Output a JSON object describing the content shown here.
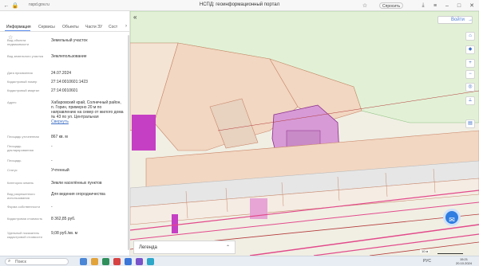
{
  "browser": {
    "url": "nspd.gov.ru",
    "page_title": "НСПД: геоинформационный портал",
    "share_label": "Спросить",
    "lang_label": "RU"
  },
  "panel": {
    "tabs": [
      {
        "label": "Информация"
      },
      {
        "label": "Сервисы"
      },
      {
        "label": "Объекты"
      },
      {
        "label": "Части ЗУ"
      },
      {
        "label": "Сост"
      }
    ],
    "more_icon": "chevron-right-icon",
    "star_icon": "star-icon",
    "rows": [
      {
        "label": "Вид объекта недвижимости",
        "value": "Земельный участок"
      },
      {
        "label": "Вид земельного участка",
        "value": "Землепользование"
      },
      {
        "label": "Дата присвоения",
        "value": "24.07.2024"
      },
      {
        "label": "Кадастровый номер",
        "value": "27:14:0010601:1423"
      },
      {
        "label": "Кадастровый квартал",
        "value": "27:14:0010601"
      },
      {
        "label": "Адрес",
        "value": "Хабаровский край, Солнечный район, п. Горин, примерно 20 м по направлению на север от жилого дома № 43 по ул. Центральная",
        "link": "Свернуть"
      },
      {
        "label": "Площадь уточненная",
        "value": "867 кв. м"
      },
      {
        "label": "Площадь декларированная",
        "value": "-"
      },
      {
        "label": "Площадь",
        "value": "-"
      },
      {
        "label": "Статус",
        "value": "Учтенный"
      },
      {
        "label": "Категория земель",
        "value": "Земли населённых пунктов"
      },
      {
        "label": "Вид разрешенного использования",
        "value": "Для ведения огородничества"
      },
      {
        "label": "Форма собственности",
        "value": "-"
      },
      {
        "label": "Кадастровая стоимость",
        "value": "8 362,85 руб."
      },
      {
        "label": "Удельный показатель кадастровой стоимости",
        "value": "9,08 руб./кв. м"
      }
    ]
  },
  "map": {
    "login_label": "Войти",
    "legend_label": "Легенда",
    "scale_label": "10 м",
    "colors": {
      "land": "#f1efe4",
      "parcel_fill": "#f2d7c2",
      "parcel_stroke": "#c9876a",
      "green": "#e2f1d6",
      "selected": "#d79ad6",
      "magenta": "#c53fc4",
      "road": "#e6e6e6",
      "pink_line": "#e24a8a",
      "red_line": "#b33a3a"
    },
    "side_buttons": [
      "home-icon",
      "layers-icon",
      "plus-icon",
      "minus-icon",
      "location-icon",
      "ruler-icon",
      "print-icon"
    ]
  },
  "taskbar": {
    "search_placeholder": "Поиск",
    "time": "15:21",
    "date": "20.10.2024",
    "lang": "РУС"
  }
}
